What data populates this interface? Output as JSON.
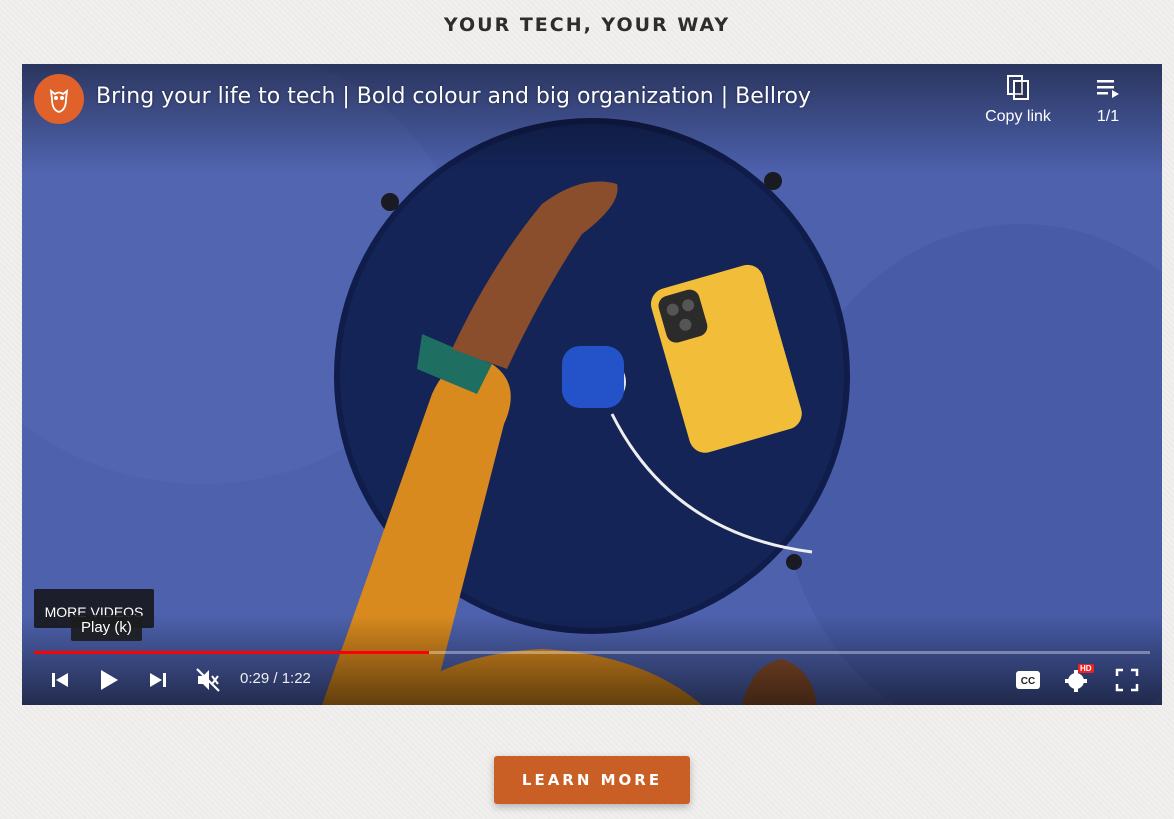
{
  "section": {
    "title": "YOUR TECH, YOUR WAY"
  },
  "video": {
    "title": "Bring your life to tech | Bold colour and big organization | Bellroy",
    "channel_logo": "owl-logo-icon",
    "copy_link_label": "Copy link",
    "playlist_count": "1/1",
    "more_videos_label": "MORE VIDEOS",
    "tooltip": "Play (k)",
    "time": "0:29 / 1:22",
    "progress_fraction": 0.354,
    "hd_badge": "HD",
    "colors": {
      "progress": "#ff0000",
      "logo_bg": "#e0622a"
    }
  },
  "cta": {
    "label": "LEARN MORE",
    "color": "#c95f24"
  }
}
